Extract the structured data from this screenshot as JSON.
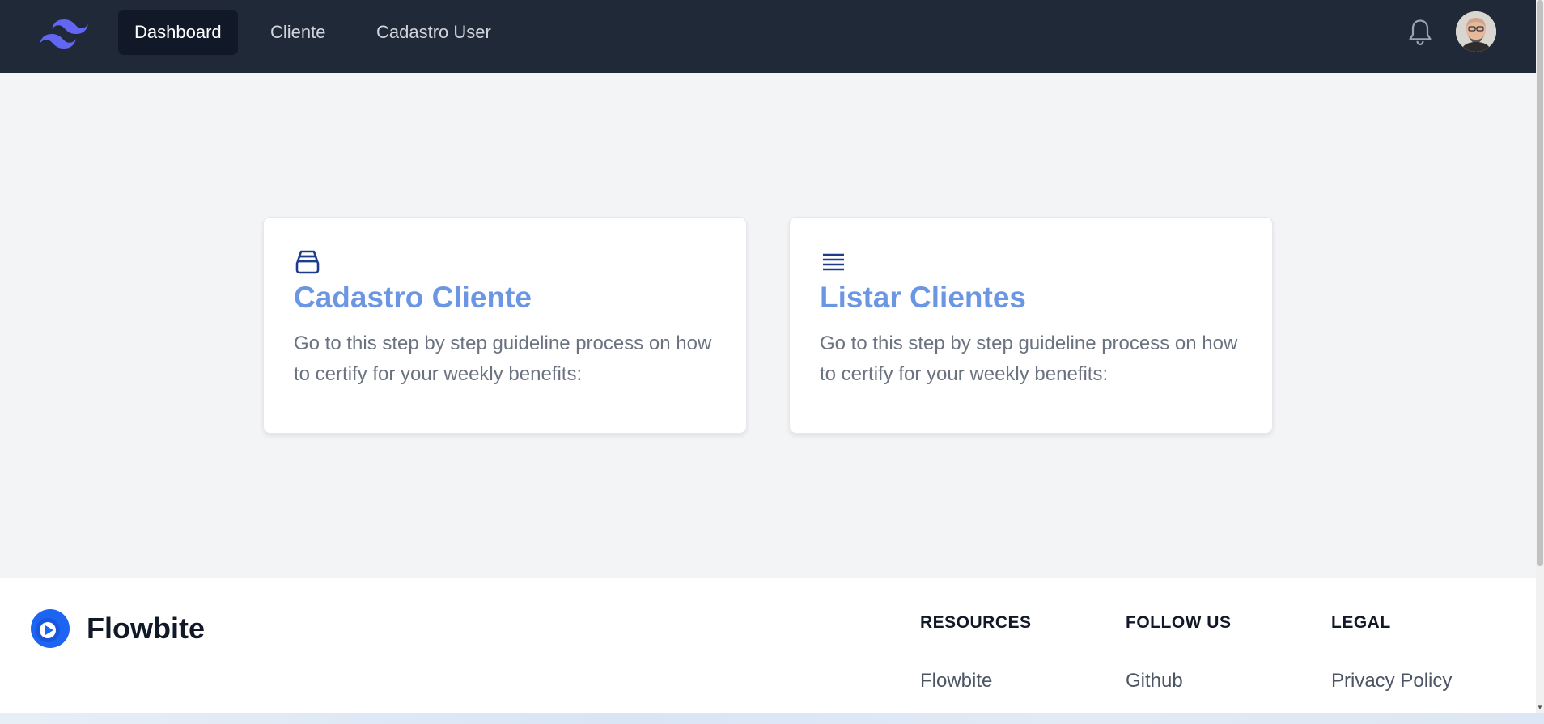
{
  "nav": {
    "logo_icon": "tailwind-logo-icon",
    "items": [
      {
        "label": "Dashboard",
        "active": true
      },
      {
        "label": "Cliente",
        "active": false
      },
      {
        "label": "Cadastro User",
        "active": false
      }
    ],
    "bell_icon": "bell-icon",
    "avatar_icon": "user-avatar"
  },
  "cards": [
    {
      "icon": "inbox-stack-icon",
      "title": "Cadastro Cliente",
      "text": "Go to this step by step guideline process on how to certify for your weekly benefits:"
    },
    {
      "icon": "list-lines-icon",
      "title": "Listar Clientes",
      "text": "Go to this step by step guideline process on how to certify for your weekly benefits:"
    }
  ],
  "footer": {
    "brand": "Flowbite",
    "brand_icon": "flowbite-logo-icon",
    "columns": [
      {
        "heading": "RESOURCES",
        "link": "Flowbite"
      },
      {
        "heading": "FOLLOW US",
        "link": "Github"
      },
      {
        "heading": "LEGAL",
        "link": "Privacy Policy"
      }
    ]
  },
  "colors": {
    "nav_bg": "#1f2937",
    "active_item_bg": "#111827",
    "card_title": "#6b96e3",
    "card_icon": "#1e3a8a",
    "logo": "#6366f1",
    "page_bg": "#f3f4f6"
  }
}
